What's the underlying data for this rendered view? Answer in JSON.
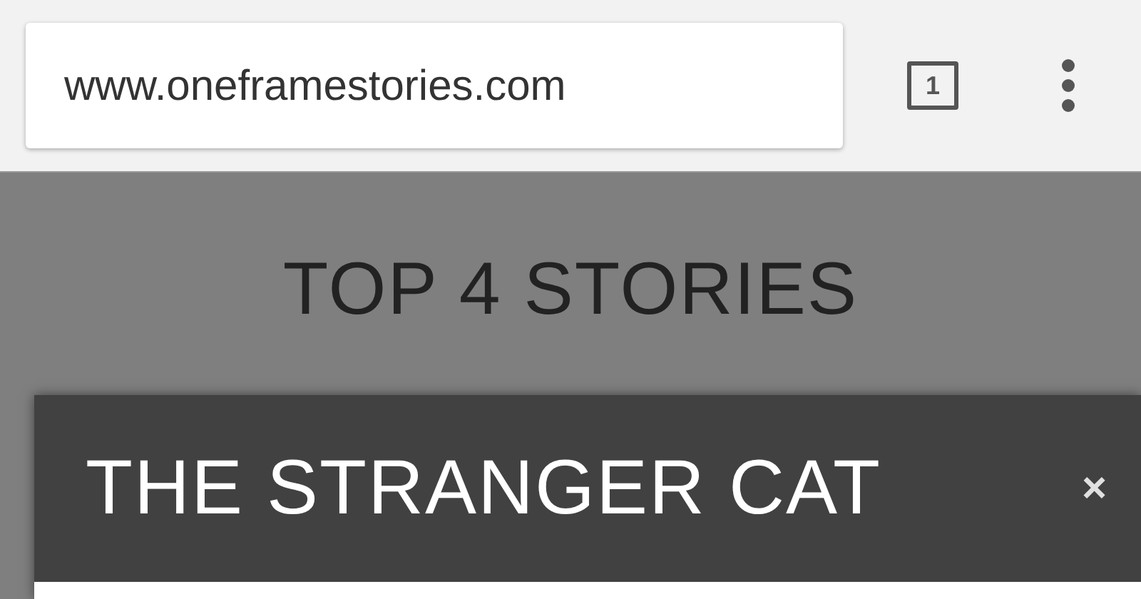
{
  "browser": {
    "url": "www.oneframestories.com",
    "tab_count": "1"
  },
  "page": {
    "heading": "TOP 4 STORIES"
  },
  "dialog": {
    "title": "THE STRANGER CAT",
    "close": "×"
  }
}
